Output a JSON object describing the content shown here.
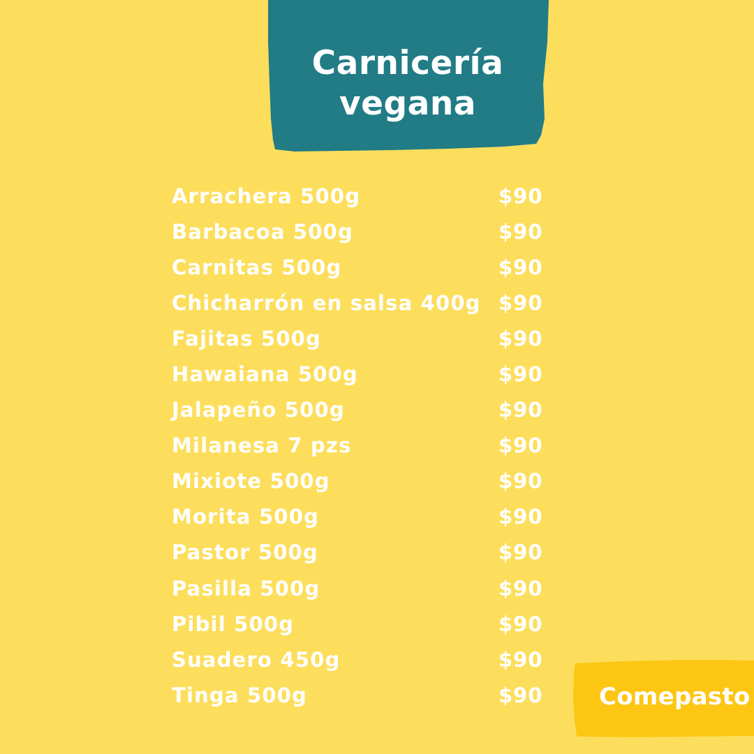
{
  "colors": {
    "background": "#FDDE5C",
    "title_banner": "#217C86",
    "brand_badge": "#FDC613",
    "text": "#FFFFFF"
  },
  "title": {
    "line1": "Carnicería",
    "line2": "vegana"
  },
  "items": [
    {
      "name": "Arrachera 500g",
      "price": "$90"
    },
    {
      "name": "Barbacoa 500g",
      "price": "$90"
    },
    {
      "name": "Carnitas 500g",
      "price": "$90"
    },
    {
      "name": "Chicharrón en salsa 400g",
      "price": "$90"
    },
    {
      "name": "Fajitas 500g",
      "price": "$90"
    },
    {
      "name": "Hawaiana 500g",
      "price": "$90"
    },
    {
      "name": "Jalapeño 500g",
      "price": "$90"
    },
    {
      "name": "Milanesa 7 pzs",
      "price": "$90"
    },
    {
      "name": "Mixiote 500g",
      "price": "$90"
    },
    {
      "name": "Morita 500g",
      "price": "$90"
    },
    {
      "name": "Pastor 500g",
      "price": "$90"
    },
    {
      "name": "Pasilla 500g",
      "price": "$90"
    },
    {
      "name": "Pibil 500g",
      "price": "$90"
    },
    {
      "name": "Suadero 450g",
      "price": "$90"
    },
    {
      "name": "Tinga 500g",
      "price": "$90"
    }
  ],
  "brand": {
    "name": "Comepasto"
  }
}
